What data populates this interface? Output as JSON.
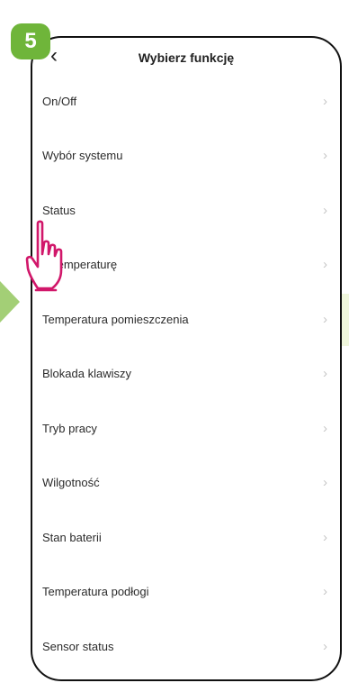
{
  "step_badge": "5",
  "header": {
    "back_icon": "chevron-left",
    "back_glyph": "‹",
    "title": "Wybierz funkcję"
  },
  "list": {
    "items": [
      {
        "label": "On/Off"
      },
      {
        "label": "Wybór systemu"
      },
      {
        "label": "Status"
      },
      {
        "label": "w temperaturę"
      },
      {
        "label": "Temperatura pomieszczenia"
      },
      {
        "label": "Blokada klawiszy"
      },
      {
        "label": "Tryb pracy"
      },
      {
        "label": "Wilgotność"
      },
      {
        "label": "Stan baterii"
      },
      {
        "label": "Temperatura podłogi"
      },
      {
        "label": "Sensor status"
      }
    ],
    "chevron_glyph": "›"
  },
  "colors": {
    "accent_green": "#6fb53a",
    "pointer_pink": "#d1176a"
  }
}
